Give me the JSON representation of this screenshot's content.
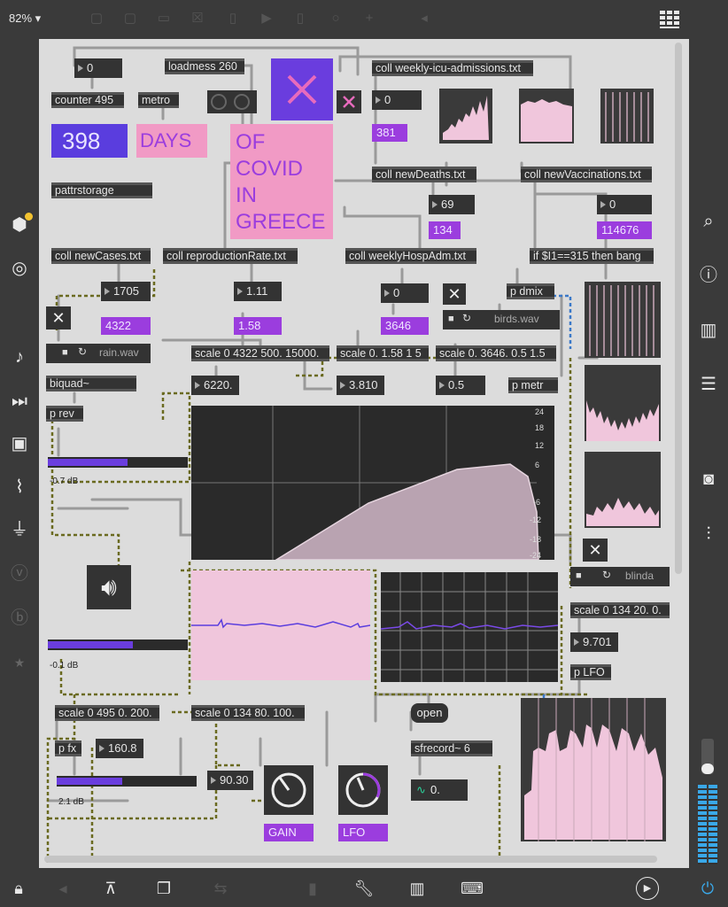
{
  "topbar": {
    "zoom": "82%"
  },
  "patch": {
    "title_days_number": "398",
    "title_days_word": "DAYS",
    "title_lines": [
      "OF",
      "COVID",
      "IN",
      "GREECE"
    ],
    "objects": {
      "num0": "0",
      "loadmess": "loadmess 260",
      "counter": "counter 495",
      "metro": "metro",
      "pattr": "pattrstorage",
      "coll_icu": "coll weekly-icu-admissions.txt",
      "icu_num": "0",
      "icu_msg": "381",
      "coll_deaths": "coll newDeaths.txt",
      "deaths_num": "69",
      "deaths_msg": "134",
      "coll_vacc": "coll newVaccinations.txt",
      "vacc_num": "0",
      "vacc_msg": "114676",
      "coll_cases": "coll newCases.txt",
      "cases_num": "1705",
      "cases_msg": "4322",
      "coll_repro": "coll reproductionRate.txt",
      "repro_num": "1.11",
      "repro_msg": "1.58",
      "coll_hosp": "coll weeklyHospAdm.txt",
      "hosp_num": "0",
      "hosp_msg": "3646",
      "ifbang": "if $I1==315 then bang",
      "pdmix": "p dmix",
      "birds": "birds.wav",
      "rain": "rain.wav",
      "biquad": "biquad~",
      "prev": "p rev",
      "scale1": "scale 0 4322 500. 15000.",
      "scale2": "scale 0. 1.58 1 5",
      "scale3": "scale 0. 3646. 0.5 1.5",
      "num6220": "6220.",
      "num3810": "3.810",
      "num05": "0.5",
      "pmetr": "p metr",
      "db1": "-0.7 dB",
      "db2": "-0.1 dB",
      "db3": "2.1 dB",
      "blinda": "blinda",
      "scale4": "scale 0 134 20. 0.",
      "num9701": "9.701",
      "plfo": "p LFO",
      "scale5": "scale 0 495 0. 200.",
      "scale6": "scale 0 134 80. 100.",
      "pfx": "p fx",
      "num1608": "160.8",
      "num9030": "90.30",
      "open": "open",
      "sfrecord": "sfrecord~ 6",
      "sig0": "0.",
      "gain": "GAIN",
      "lfo": "LFO"
    },
    "filter_graph": {
      "y_ticks": [
        "24",
        "18",
        "12",
        "6",
        "-6",
        "-12",
        "-18",
        "-24"
      ]
    }
  },
  "colors": {
    "accent": "#9b3dde",
    "pink": "#f19ac5",
    "canvas": "#dcdcdc",
    "dark": "#333333"
  }
}
